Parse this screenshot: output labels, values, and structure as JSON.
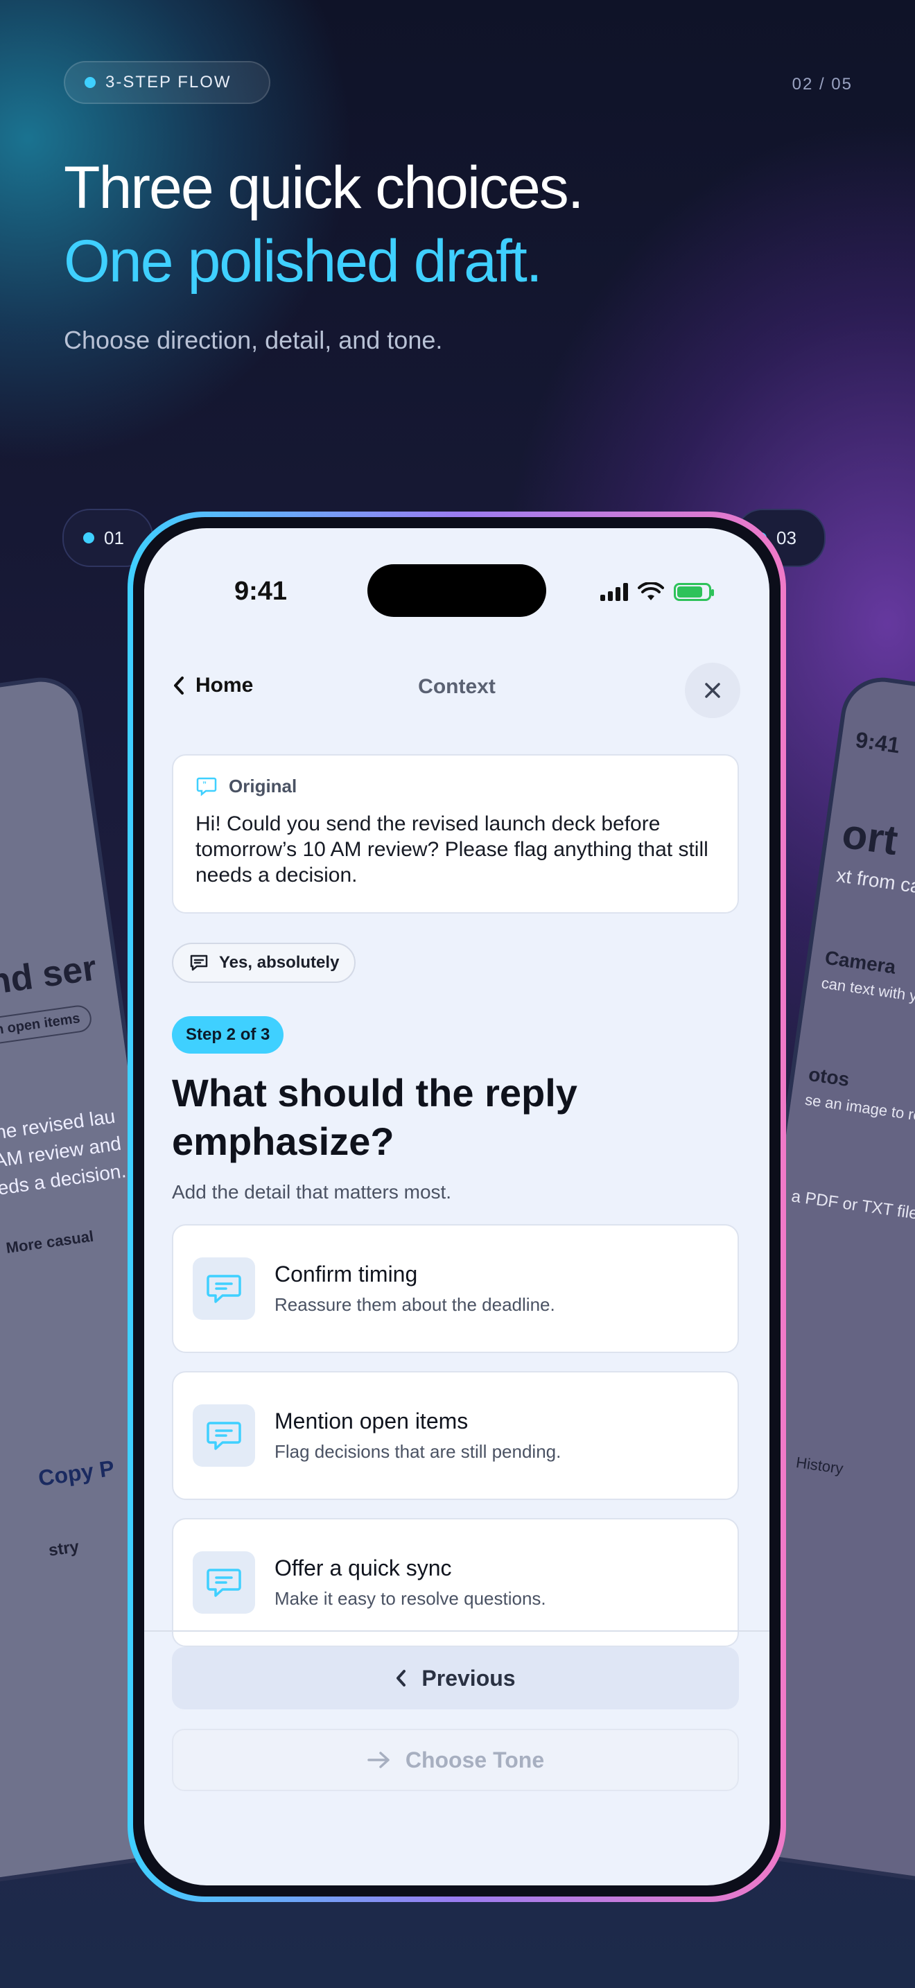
{
  "promo": {
    "flow_label": "3-STEP FLOW",
    "counter": "02 / 05",
    "headline_line1": "Three quick choices.",
    "headline_line2": "One polished draft.",
    "subline": "Choose direction, detail, and tone.",
    "step_left": "01",
    "step_right": "03",
    "accent_color": "#3fd0ff"
  },
  "left_phone": {
    "partial_heading": "and ser",
    "partial_chip": "on open items",
    "partial_text1": "the revised lau",
    "partial_text2": "AM review and",
    "partial_text3": "eds a decision.",
    "chip2": "More casual",
    "copy": "Copy P",
    "bottom": "stry"
  },
  "right_phone": {
    "time": "9:41",
    "heading": "ort",
    "sub": "xt from camera",
    "item1_title": "Camera",
    "item1_sub": "can text with your",
    "item2_title": "otos",
    "item2_sub": "se an image to re",
    "item3_sub": "a PDF or TXT file",
    "tab_history": "History"
  },
  "status_bar": {
    "time": "9:41"
  },
  "nav": {
    "back_label": "Home",
    "title": "Context"
  },
  "original": {
    "label": "Original",
    "text": "Hi! Could you send the revised launch deck before tomorrow’s 10 AM review? Please flag anything that still needs a decision."
  },
  "selected_chip": "Yes, absolutely",
  "step_badge": "Step 2 of 3",
  "question": {
    "title": "What should the reply emphasize?",
    "subtitle": "Add the detail that matters most."
  },
  "options": [
    {
      "title": "Confirm timing",
      "desc": "Reassure them about the deadline.",
      "icon": "message-icon"
    },
    {
      "title": "Mention open items",
      "desc": "Flag decisions that are still pending.",
      "icon": "message-icon"
    },
    {
      "title": "Offer a quick sync",
      "desc": "Make it easy to resolve questions.",
      "icon": "message-icon"
    }
  ],
  "buttons": {
    "previous": "Previous",
    "next": "Choose Tone"
  }
}
